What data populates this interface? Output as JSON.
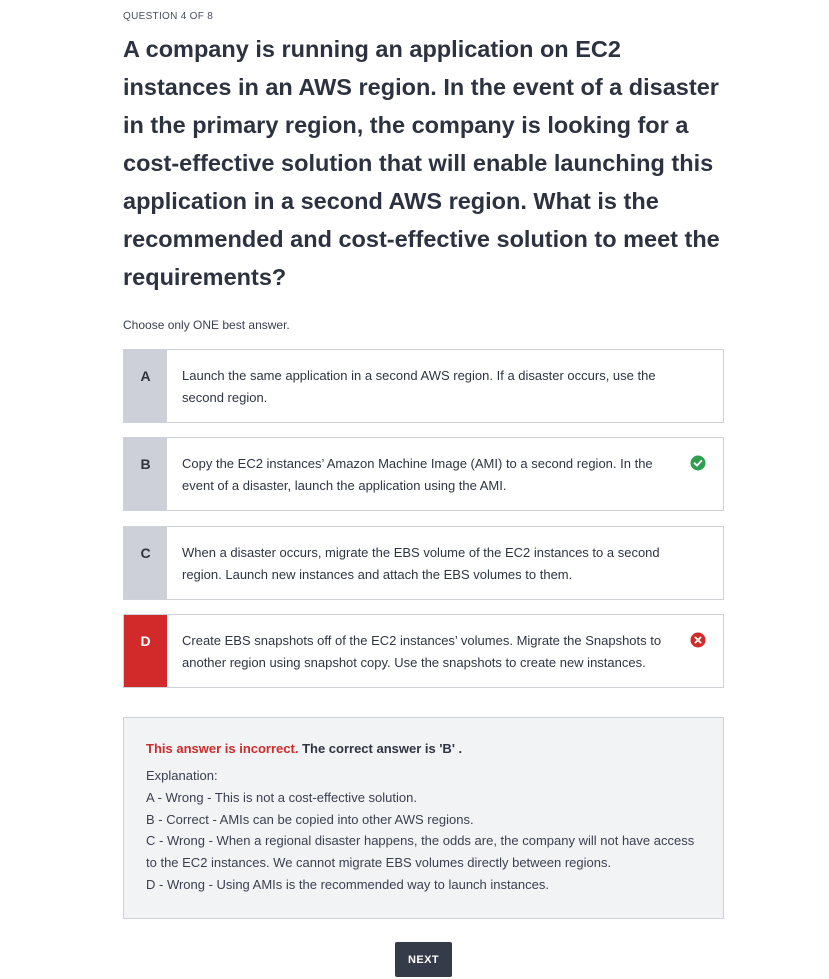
{
  "quiz": {
    "counter": "QUESTION 4 OF 8",
    "question": "A company is running an application on EC2 instances in an AWS region. In the event of a disaster in the primary region, the company is looking for a cost-effective solution that will enable launching this application in a second AWS region. What is the recommended and cost-effective solution to meet the requirements?",
    "instruction": "Choose only ONE best answer.",
    "options": [
      {
        "letter": "A",
        "text": "Launch the same application in a second AWS region. If a disaster occurs, use the second region.",
        "state": "neutral"
      },
      {
        "letter": "B",
        "text": "Copy the EC2 instances’ Amazon Machine Image (AMI) to a second region. In the event of a disaster, launch the application using the AMI.",
        "state": "correct",
        "icon": "check-circle-icon"
      },
      {
        "letter": "C",
        "text": "When a disaster occurs, migrate the EBS volume of the EC2 instances to a second region. Launch new instances and attach the EBS volumes to them.",
        "state": "neutral"
      },
      {
        "letter": "D",
        "text": "Create EBS snapshots off of the EC2 instances’ volumes. Migrate the Snapshots to another region using snapshot copy. Use the snapshots to create new instances.",
        "state": "wrong",
        "icon": "x-circle-icon"
      }
    ],
    "feedback": {
      "incorrect_label": "This answer is incorrect.",
      "correct_answer_text": " The correct answer is 'B' .",
      "explanation_title": "Explanation:",
      "lines": [
        "A - Wrong - This is not a cost-effective solution.",
        "B - Correct - AMIs can be copied into other AWS regions.",
        "C - Wrong - When a regional disaster happens, the odds are, the company will not have access to the EC2 instances. We cannot migrate EBS volumes directly between regions.",
        "D - Wrong - Using AMIs is the recommended way to launch instances."
      ]
    },
    "next_label": "NEXT"
  },
  "colors": {
    "correct": "#2e9e4f",
    "wrong": "#d22a2a",
    "letter_bg": "#cdd0d8",
    "button_bg": "#363b4a"
  }
}
